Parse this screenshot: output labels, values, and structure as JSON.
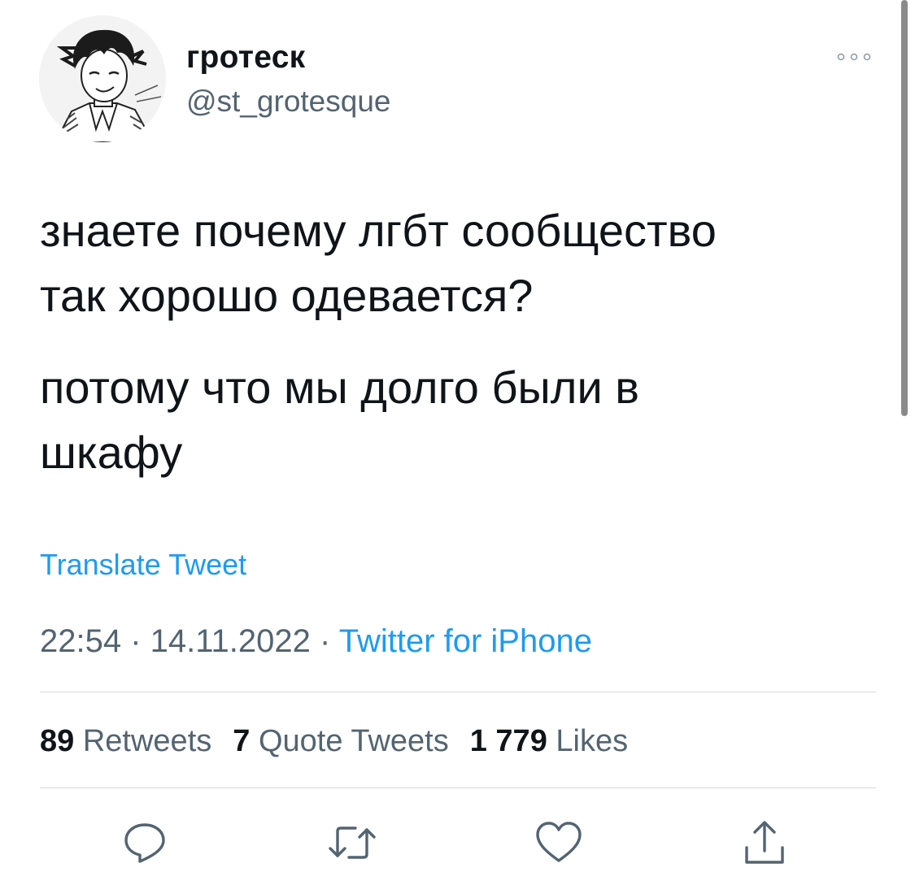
{
  "author": {
    "display_name": "гротеск",
    "handle": "@st_grotesque"
  },
  "tweet": {
    "paragraph_1": "знаете почему лгбт сообщество\nтак хорошо одевается?",
    "paragraph_2": "потому что мы долго были в\nшкафу"
  },
  "translate_label": "Translate Tweet",
  "meta": {
    "time": "22:54",
    "separator": " · ",
    "date": "14.11.2022",
    "source": "Twitter for iPhone"
  },
  "stats": {
    "retweets_count": "89",
    "retweets_label": "Retweets",
    "quotes_count": "7",
    "quotes_label": "Quote Tweets",
    "likes_count": "1 779",
    "likes_label": "Likes"
  },
  "icons": {
    "more": "more-horizontal-icon",
    "reply": "reply-icon",
    "retweet": "retweet-icon",
    "like": "heart-icon",
    "share": "share-icon"
  },
  "colors": {
    "text": "#0f1419",
    "secondary": "#536471",
    "link": "#1d9bf0",
    "divider": "#d7dbdf",
    "icon": "#536471"
  }
}
